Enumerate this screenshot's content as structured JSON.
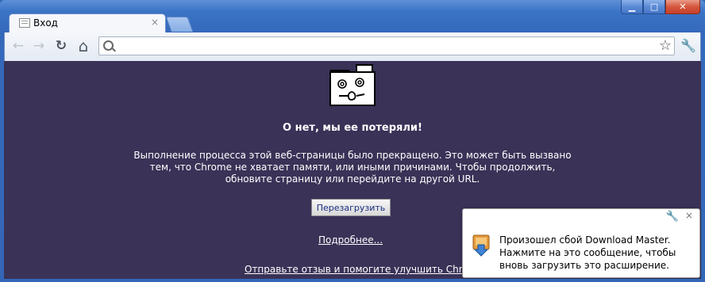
{
  "window": {
    "minimize_label": "▁",
    "maximize_label": "□",
    "close_label": "✕"
  },
  "tab": {
    "title": "Вход",
    "close_label": "×"
  },
  "toolbar": {
    "back_label": "←",
    "forward_label": "→",
    "reload_label": "↻",
    "home_label": "⌂",
    "star_label": "☆",
    "wrench_label": "🔧"
  },
  "omnibox": {
    "value": "",
    "placeholder": ""
  },
  "crash": {
    "title": "О нет, мы ее потеряли!",
    "description": "Выполнение процесса этой веб-страницы было прекращено. Это может быть вызвано тем, что Chrome не хватает памяти, или иными причинами. Чтобы продолжить, обновите страницу или перейдите на другой URL.",
    "reload_button": "Перезагрузить",
    "more_link": "Подробнее...",
    "feedback_link": "Отправьте отзыв и помогите улучшить Chrome"
  },
  "balloon": {
    "message": "Произошел сбой Download Master. Нажмите на это сообщение, чтобы вновь загрузить это расширение.",
    "close_label": "×",
    "wrench_label": "🔧"
  },
  "colors": {
    "content_bg": "#3a3257",
    "frame": "#3466b7",
    "link": "#ffffff"
  }
}
